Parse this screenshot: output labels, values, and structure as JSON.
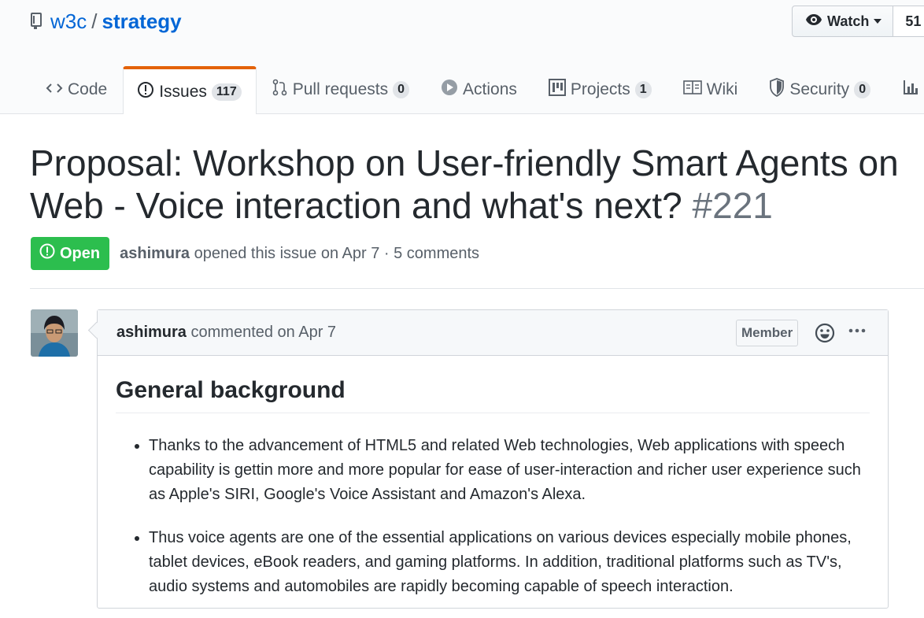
{
  "repo": {
    "owner": "w3c",
    "separator": "/",
    "name": "strategy"
  },
  "watch": {
    "label": "Watch",
    "count": "51"
  },
  "tabs": [
    {
      "label": "Code",
      "icon": "code-icon"
    },
    {
      "label": "Issues",
      "icon": "issue-opened-icon",
      "count": "117"
    },
    {
      "label": "Pull requests",
      "icon": "git-pull-request-icon",
      "count": "0"
    },
    {
      "label": "Actions",
      "icon": "play-icon"
    },
    {
      "label": "Projects",
      "icon": "project-icon",
      "count": "1"
    },
    {
      "label": "Wiki",
      "icon": "book-icon"
    },
    {
      "label": "Security",
      "icon": "shield-icon",
      "count": "0"
    }
  ],
  "issue": {
    "title_line1": "Proposal: Workshop on User-friendly Smart Agents on",
    "title_line2": "Web - Voice interaction and what's next?",
    "number": "#221",
    "state": "Open",
    "author": "ashimura",
    "meta_text": "opened this issue on Apr 7 · 5 comments"
  },
  "comment": {
    "author": "ashimura",
    "action": "commented on Apr 7",
    "badge": "Member",
    "heading": "General background",
    "bullets": [
      "Thanks to the advancement of HTML5 and related Web technologies, Web applications with speech capability is gettin more and more popular for ease of user-interaction and richer user experience such as Apple's SIRI, Google's Voice Assistant and Amazon's Alexa.",
      "Thus voice agents are one of the essential applications on various devices especially mobile phones, tablet devices, eBook readers, and gaming platforms. In addition, traditional platforms such as TV's, audio systems and automobiles are rapidly becoming capable of speech interaction."
    ]
  },
  "colors": {
    "link": "#0366d6",
    "open_badge": "#2cbe4e",
    "tab_accent": "#e36209",
    "muted": "#586069"
  }
}
